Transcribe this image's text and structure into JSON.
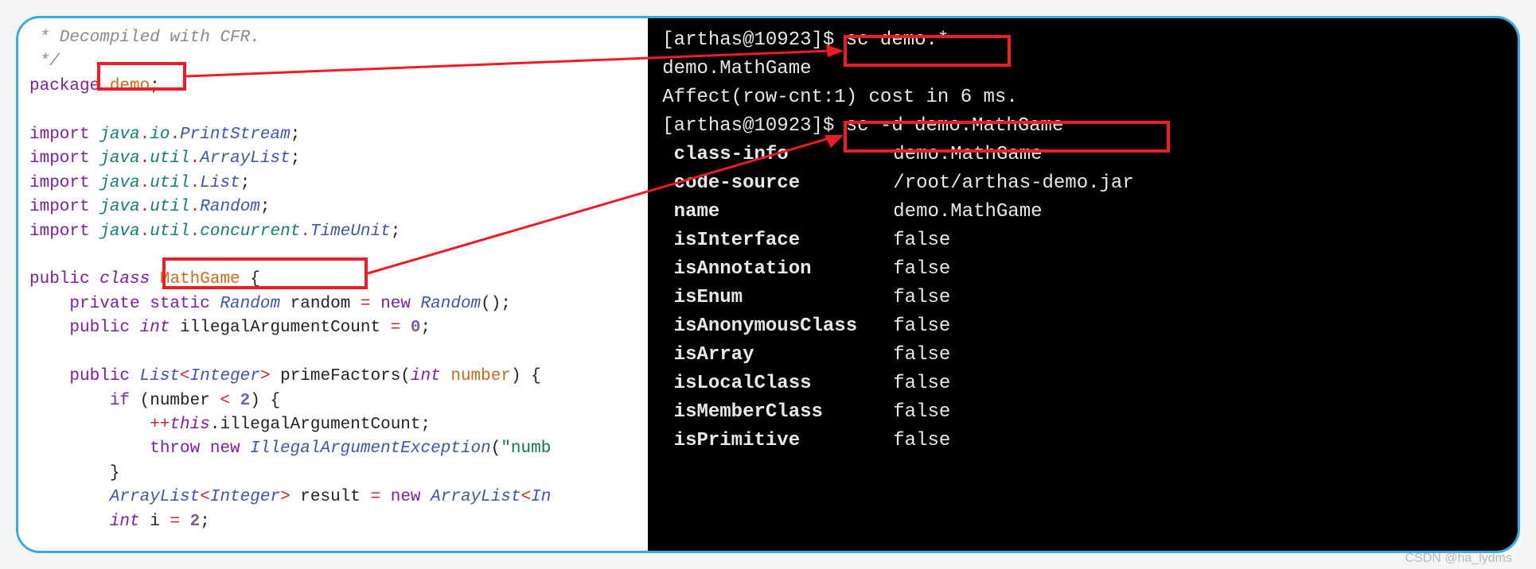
{
  "code": {
    "comment1": " * Decompiled with CFR.",
    "comment2": " */",
    "pkg_kw": "package ",
    "pkg_name": "demo",
    "imp_kw": "import ",
    "imp1_a": "java",
    "imp1_b": "io",
    "imp1_c": "PrintStream",
    "imp2_a": "java",
    "imp2_b": "util",
    "imp2_c": "ArrayList",
    "imp3_a": "java",
    "imp3_b": "util",
    "imp3_c": "List",
    "imp4_a": "java",
    "imp4_b": "util",
    "imp4_c": "Random",
    "imp5_a": "java",
    "imp5_b": "util",
    "imp5_c": "concurrent",
    "imp5_d": "TimeUnit",
    "cls_pub": "public ",
    "cls_kw": "class ",
    "cls_name": "MathGame",
    "cls_ob": " {",
    "fld1_a": "    private static ",
    "fld1_b": "Random",
    "fld1_c": " random ",
    "fld1_eq": "=",
    "fld1_d": " new ",
    "fld1_e": "Random",
    "fld1_f": "();",
    "fld2_a": "    public ",
    "fld2_b": "int",
    "fld2_c": " illegalArgumentCount ",
    "fld2_eq": "=",
    "fld2_d": " ",
    "fld2_num": "0",
    "fld2_e": ";",
    "meth_a": "    public ",
    "meth_b": "List",
    "meth_lt": "<",
    "meth_c": "Integer",
    "meth_gt": ">",
    "meth_d": " primeFactors(",
    "meth_e": "int",
    "meth_f": " number",
    "meth_g": ") {",
    "if_a": "        if ",
    "if_b": "(number ",
    "if_op": "<",
    "if_c": " ",
    "if_num": "2",
    "if_d": ") {",
    "inc_a": "            ++",
    "inc_b": "this",
    "inc_c": ".illegalArgumentCount;",
    "thr_a": "            throw new ",
    "thr_b": "IllegalArgumentException",
    "thr_c": "(",
    "thr_str": "\"numb",
    "cb": "        }",
    "arr_a": "        ",
    "arr_b": "ArrayList",
    "arr_lt": "<",
    "arr_c": "Integer",
    "arr_gt": ">",
    "arr_d": " result ",
    "arr_eq": "=",
    "arr_e": " new ",
    "arr_f": "ArrayList",
    "arr_lt2": "<",
    "arr_g": "In",
    "int_a": "        ",
    "int_b": "int",
    "int_c": " i ",
    "int_eq": "=",
    "int_d": " ",
    "int_num": "2",
    "int_e": ";"
  },
  "term": {
    "p1_prompt": "[arthas@10923]$ ",
    "p1_cmd": "sc demo.*",
    "l2": "demo.MathGame",
    "l3": "Affect(row-cnt:1) cost in 6 ms.",
    "p2_prompt": "[arthas@10923]$ ",
    "p2_cmd": "sc -d demo.MathGame",
    "rows": [
      {
        "k": " class-info",
        "v": "demo.MathGame"
      },
      {
        "k": " code-source",
        "v": "/root/arthas-demo.jar"
      },
      {
        "k": " name",
        "v": "demo.MathGame"
      },
      {
        "k": " isInterface",
        "v": "false"
      },
      {
        "k": " isAnnotation",
        "v": "false"
      },
      {
        "k": " isEnum",
        "v": "false"
      },
      {
        "k": " isAnonymousClass",
        "v": "false"
      },
      {
        "k": " isArray",
        "v": "false"
      },
      {
        "k": " isLocalClass",
        "v": "false"
      },
      {
        "k": " isMemberClass",
        "v": "false"
      },
      {
        "k": " isPrimitive",
        "v": "false"
      }
    ]
  },
  "watermark": "CSDN @ha_lydms"
}
